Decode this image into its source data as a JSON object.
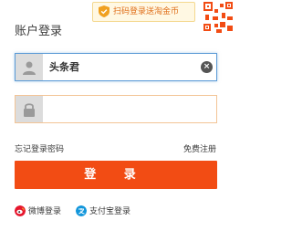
{
  "header": {
    "title": "账户登录",
    "qr_tip": "扫码登录送淘金币"
  },
  "form": {
    "username_value": "头条君",
    "password_value": ""
  },
  "links": {
    "forgot_password": "忘记登录密码",
    "register": "免费注册"
  },
  "login_button": "登 录",
  "social": {
    "weibo": "微博登录",
    "alipay": "支付宝登录"
  },
  "colors": {
    "accent": "#f24c14",
    "focus_border": "#5c9bd6",
    "tip_text": "#e0701c"
  }
}
